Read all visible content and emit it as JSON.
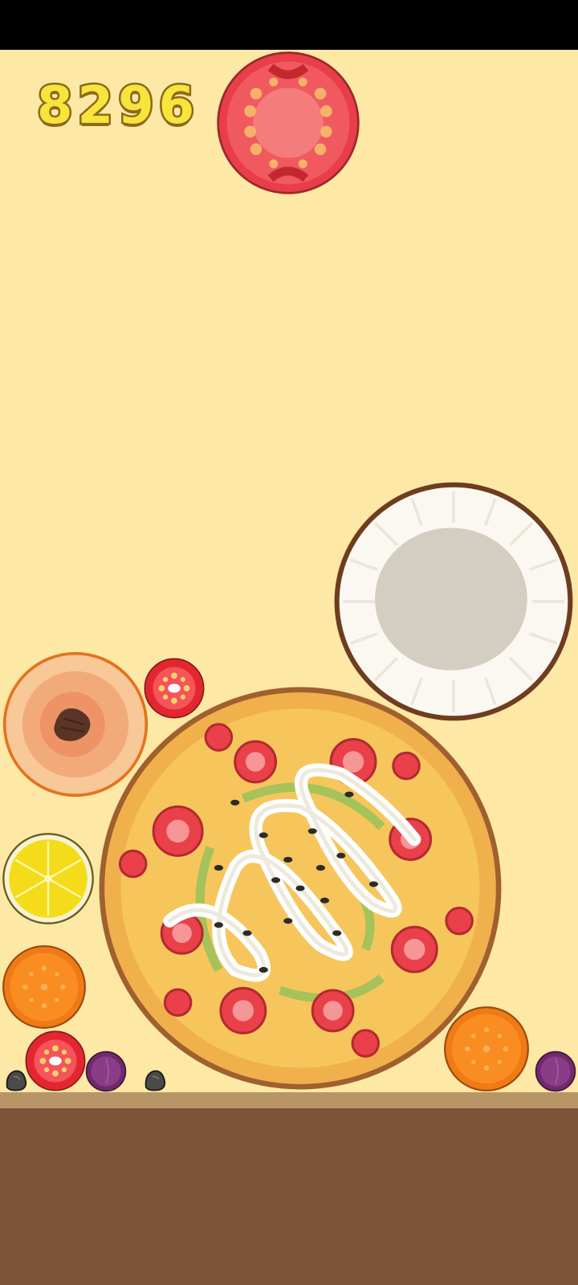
{
  "game": {
    "score": "8296",
    "colors": {
      "background": "#fde8a6",
      "ground": "#7c543a",
      "ground_edge": "#b89567",
      "score_fill": "#f7e43c",
      "score_outline": "#8a6a1a"
    },
    "next_piece": "tomato-slice",
    "pieces": [
      "tomato-slice",
      "coconut",
      "peach",
      "cherry-tomato",
      "pizza",
      "lemon-slice",
      "orange-slice",
      "plum",
      "seed"
    ]
  }
}
